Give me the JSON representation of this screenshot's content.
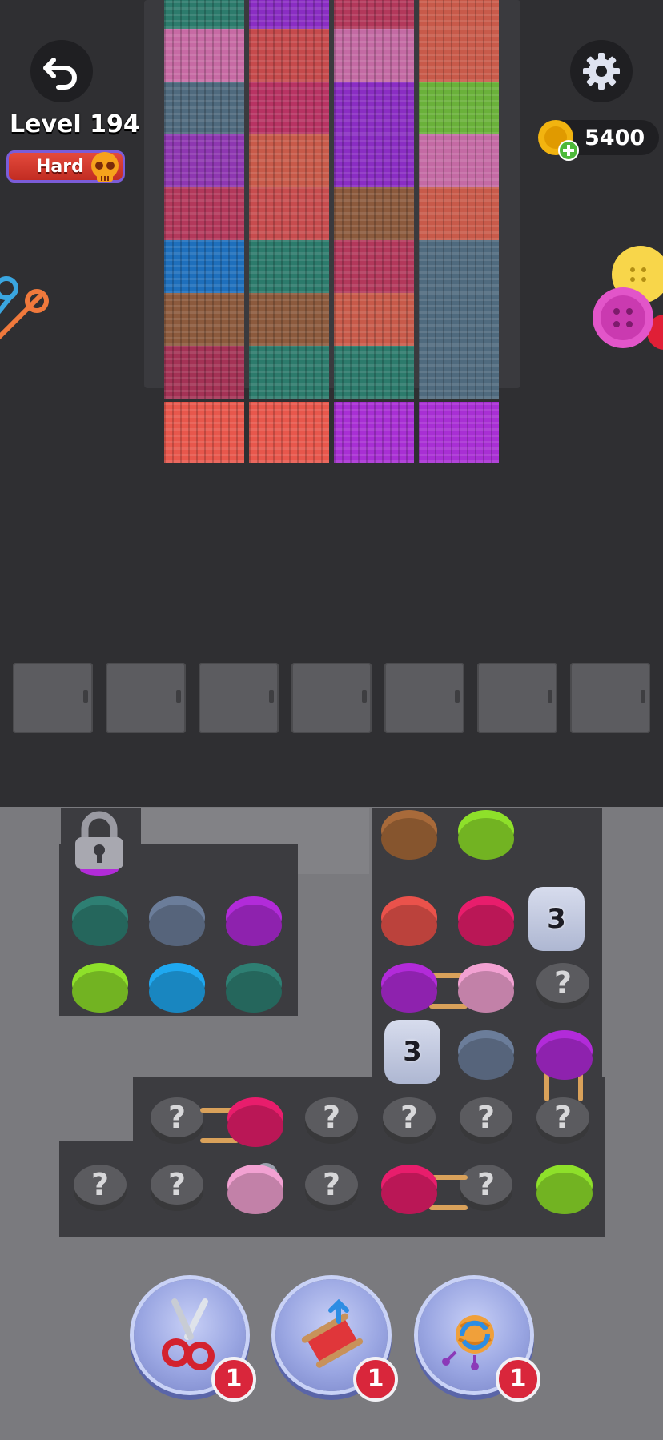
{
  "hud": {
    "level_label": "Level 194",
    "difficulty_label": "Hard",
    "coins": "5400",
    "undo_icon": "undo-arrow-icon",
    "settings_icon": "gear-icon",
    "difficulty_icon": "skull-icon",
    "coin_icon": "gold-coin-icon"
  },
  "scarves": {
    "columns": [
      {
        "blocks": [
          "#2c7b6c",
          "#c76aa4",
          "#4f6a7e",
          "#8e37b1",
          "#b3385b",
          "#1e6fbc",
          "#8c5a3d",
          "#a43255"
        ],
        "tail": "#e8574c"
      },
      {
        "blocks": [
          "#8a2dc3",
          "#c64a4c",
          "#b83363",
          "#c85a4a",
          "#c74c4e",
          "#2c7b6c",
          "#8c5a3d",
          "#2c7b6c"
        ],
        "tail": "#e8574c"
      },
      {
        "blocks": [
          "#b3385b",
          "#c46aa4",
          "#8a2dc3",
          "#8a2dc3",
          "#8c5a3d",
          "#b3385b",
          "#c85a4a",
          "#2c7b6c"
        ],
        "tail": "#a82fd4"
      },
      {
        "blocks": [
          "#c85a4a",
          "#c85a4a",
          "#6ab13a",
          "#c46aa4",
          "#c85a4a",
          "#4f6a7e",
          "#4f6a7e",
          "#4f6a7e"
        ],
        "tail": "#a82fd4"
      }
    ]
  },
  "holder": {
    "slot_count": 7
  },
  "board": {
    "locked_icon": "padlock-icon",
    "spools": [
      {
        "name": "spool-teal",
        "color": "#2e7f73"
      },
      {
        "name": "spool-slate",
        "color": "#6b7d9a"
      },
      {
        "name": "spool-magenta",
        "color": "#b22bd9"
      },
      {
        "name": "spool-lime",
        "color": "#8ee02a"
      },
      {
        "name": "spool-sky",
        "color": "#1fa8f0"
      },
      {
        "name": "spool-teal-2",
        "color": "#2e7f73"
      },
      {
        "name": "spool-brown",
        "color": "#a86a3a"
      },
      {
        "name": "spool-green",
        "color": "#8ee02a"
      },
      {
        "name": "spool-coral",
        "color": "#ea524b"
      },
      {
        "name": "spool-pink",
        "color": "#e81d6c"
      },
      {
        "name": "spool-purple",
        "color": "#b22bd9"
      },
      {
        "name": "spool-lightpink",
        "color": "#f2a1d2"
      },
      {
        "name": "spool-slate-2",
        "color": "#6b7d9a"
      },
      {
        "name": "spool-purple-2",
        "color": "#b22bd9"
      },
      {
        "name": "spool-pink-2",
        "color": "#e81d6c"
      },
      {
        "name": "spool-lightpink-key",
        "color": "#f2a1d2"
      },
      {
        "name": "spool-pink-3",
        "color": "#e81d6c"
      },
      {
        "name": "spool-lime-2",
        "color": "#8ee02a"
      }
    ],
    "mystery_symbol": "?",
    "tunnel_1_count": "3",
    "tunnel_2_count": "3"
  },
  "boosters": [
    {
      "name": "scissors-booster",
      "icon": "scissors-icon",
      "count": "1"
    },
    {
      "name": "spool-booster",
      "icon": "thread-spool-icon",
      "count": "1"
    },
    {
      "name": "shuffle-booster",
      "icon": "yarn-shuffle-icon",
      "count": "1"
    }
  ]
}
